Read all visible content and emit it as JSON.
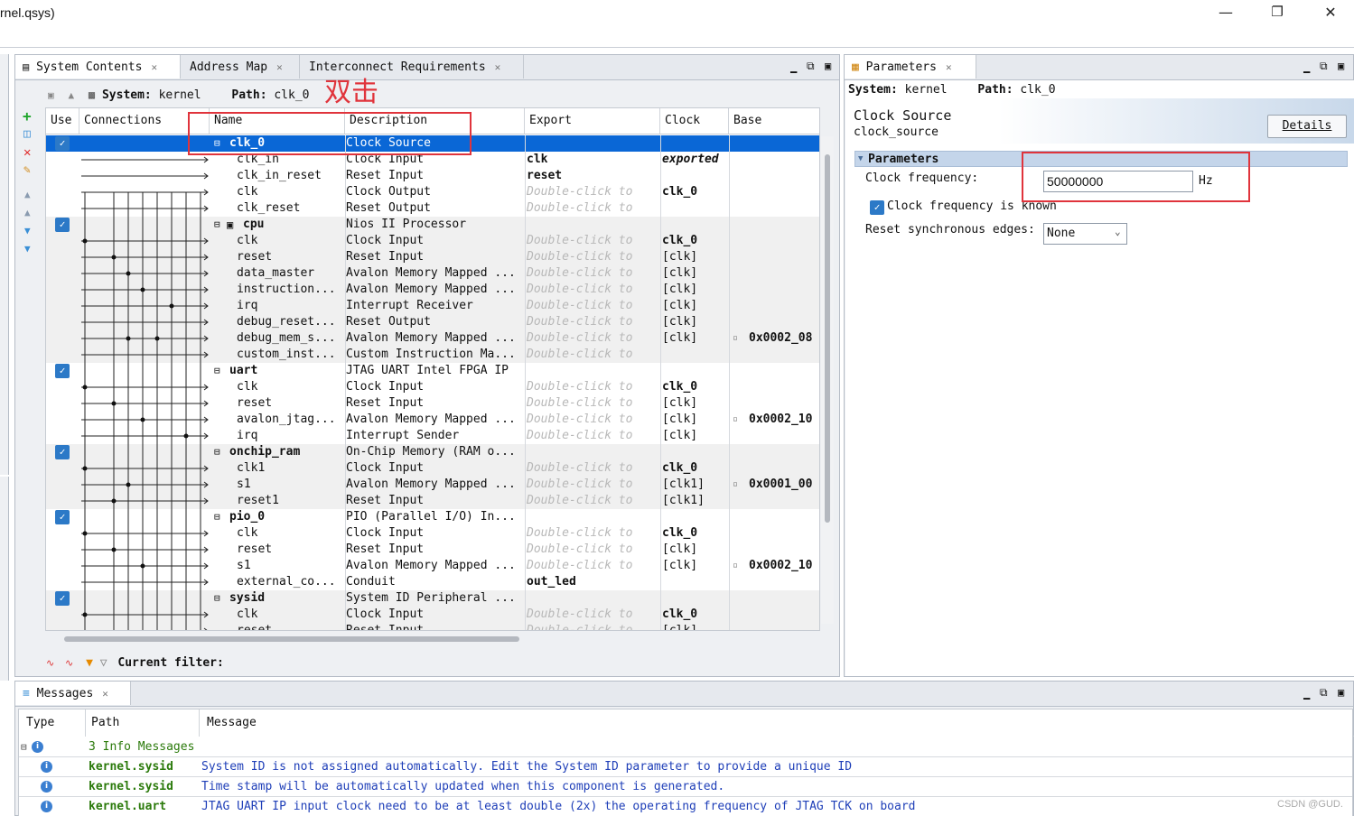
{
  "window": {
    "title": "rnel.qsys)"
  },
  "main_tabs": [
    {
      "label": "System Contents"
    },
    {
      "label": "Address Map"
    },
    {
      "label": "Interconnect Requirements"
    }
  ],
  "system_bar": {
    "system_label": "System:",
    "system_value": "kernel",
    "path_label": "Path:",
    "path_value": "clk_0"
  },
  "annotation": {
    "text": "双击"
  },
  "columns": {
    "use": "Use",
    "connections": "Connections",
    "name": "Name",
    "description": "Description",
    "export": "Export",
    "clock": "Clock",
    "base": "Base"
  },
  "rows": [
    {
      "name": "clk_0",
      "desc": "Clock Source",
      "export": "",
      "clock": "",
      "base": ""
    },
    {
      "name": "clk_in",
      "desc": "Clock Input",
      "export": "clk",
      "clock": "exported",
      "base": ""
    },
    {
      "name": "clk_in_reset",
      "desc": "Reset Input",
      "export": "reset",
      "clock": "",
      "base": ""
    },
    {
      "name": "clk",
      "desc": "Clock Output",
      "export": "Double-click to",
      "clock": "clk_0",
      "base": ""
    },
    {
      "name": "clk_reset",
      "desc": "Reset Output",
      "export": "Double-click to",
      "clock": "",
      "base": ""
    },
    {
      "name": "cpu",
      "desc": "Nios II Processor",
      "export": "",
      "clock": "",
      "base": ""
    },
    {
      "name": "clk",
      "desc": "Clock Input",
      "export": "Double-click to",
      "clock": "clk_0",
      "base": ""
    },
    {
      "name": "reset",
      "desc": "Reset Input",
      "export": "Double-click to",
      "clock": "[clk]",
      "base": ""
    },
    {
      "name": "data_master",
      "desc": "Avalon Memory Mapped ...",
      "export": "Double-click to",
      "clock": "[clk]",
      "base": ""
    },
    {
      "name": "instruction...",
      "desc": "Avalon Memory Mapped ...",
      "export": "Double-click to",
      "clock": "[clk]",
      "base": ""
    },
    {
      "name": "irq",
      "desc": "Interrupt Receiver",
      "export": "Double-click to",
      "clock": "[clk]",
      "base": ""
    },
    {
      "name": "debug_reset...",
      "desc": "Reset Output",
      "export": "Double-click to",
      "clock": "[clk]",
      "base": ""
    },
    {
      "name": "debug_mem_s...",
      "desc": "Avalon Memory Mapped ...",
      "export": "Double-click to",
      "clock": "[clk]",
      "base": "0x0002_08"
    },
    {
      "name": "custom_inst...",
      "desc": "Custom Instruction Ma...",
      "export": "Double-click to",
      "clock": "",
      "base": ""
    },
    {
      "name": "uart",
      "desc": "JTAG UART Intel FPGA IP",
      "export": "",
      "clock": "",
      "base": ""
    },
    {
      "name": "clk",
      "desc": "Clock Input",
      "export": "Double-click to",
      "clock": "clk_0",
      "base": ""
    },
    {
      "name": "reset",
      "desc": "Reset Input",
      "export": "Double-click to",
      "clock": "[clk]",
      "base": ""
    },
    {
      "name": "avalon_jtag...",
      "desc": "Avalon Memory Mapped ...",
      "export": "Double-click to",
      "clock": "[clk]",
      "base": "0x0002_10"
    },
    {
      "name": "irq",
      "desc": "Interrupt Sender",
      "export": "Double-click to",
      "clock": "[clk]",
      "base": ""
    },
    {
      "name": "onchip_ram",
      "desc": "On-Chip Memory (RAM o...",
      "export": "",
      "clock": "",
      "base": ""
    },
    {
      "name": "clk1",
      "desc": "Clock Input",
      "export": "Double-click to",
      "clock": "clk_0",
      "base": ""
    },
    {
      "name": "s1",
      "desc": "Avalon Memory Mapped ...",
      "export": "Double-click to",
      "clock": "[clk1]",
      "base": "0x0001_00"
    },
    {
      "name": "reset1",
      "desc": "Reset Input",
      "export": "Double-click to",
      "clock": "[clk1]",
      "base": ""
    },
    {
      "name": "pio_0",
      "desc": "PIO (Parallel I/O) In...",
      "export": "",
      "clock": "",
      "base": ""
    },
    {
      "name": "clk",
      "desc": "Clock Input",
      "export": "Double-click to",
      "clock": "clk_0",
      "base": ""
    },
    {
      "name": "reset",
      "desc": "Reset Input",
      "export": "Double-click to",
      "clock": "[clk]",
      "base": ""
    },
    {
      "name": "s1",
      "desc": "Avalon Memory Mapped ...",
      "export": "Double-click to",
      "clock": "[clk]",
      "base": "0x0002_10"
    },
    {
      "name": "external_co...",
      "desc": "Conduit",
      "export": "out_led",
      "clock": "",
      "base": ""
    },
    {
      "name": "sysid",
      "desc": "System ID Peripheral ...",
      "export": "",
      "clock": "",
      "base": ""
    },
    {
      "name": "clk",
      "desc": "Clock Input",
      "export": "Double-click to",
      "clock": "clk_0",
      "base": ""
    },
    {
      "name": "reset",
      "desc": "Reset Input",
      "export": "Double-click to",
      "clock": "[clk]",
      "base": ""
    }
  ],
  "filter": {
    "label": "Current filter:"
  },
  "params_tab": {
    "label": "Parameters"
  },
  "params": {
    "system_label": "System:",
    "system_value": "kernel",
    "path_label": "Path:",
    "path_value": "clk_0",
    "component_title": "Clock Source",
    "component_id": "clock_source",
    "details_button": "Details",
    "section": "Parameters",
    "freq_label": "Clock frequency:",
    "freq_value": "50000000",
    "freq_unit": "Hz",
    "known_label": "Clock frequency is known",
    "reset_label": "Reset synchronous edges:",
    "reset_value": "None"
  },
  "messages_tab": {
    "label": "Messages"
  },
  "messages": {
    "headers": {
      "type": "Type",
      "path": "Path",
      "message": "Message"
    },
    "group": "3 Info Messages",
    "items": [
      {
        "path": "kernel.sysid",
        "text": "System ID is not assigned automatically. Edit the System ID parameter to provide a unique ID"
      },
      {
        "path": "kernel.sysid",
        "text": "Time stamp will be automatically updated when this component is generated."
      },
      {
        "path": "kernel.uart",
        "text": "JTAG UART IP input clock need to be at least double (2x) the operating frequency of JTAG TCK on board"
      }
    ]
  },
  "watermark": "CSDN @GUD.",
  "colors": {
    "selection": "#0a67d6",
    "annotation_red": "#e0343c",
    "message_path_green": "#2b7a0b",
    "message_text_blue": "#1f3fb8"
  }
}
